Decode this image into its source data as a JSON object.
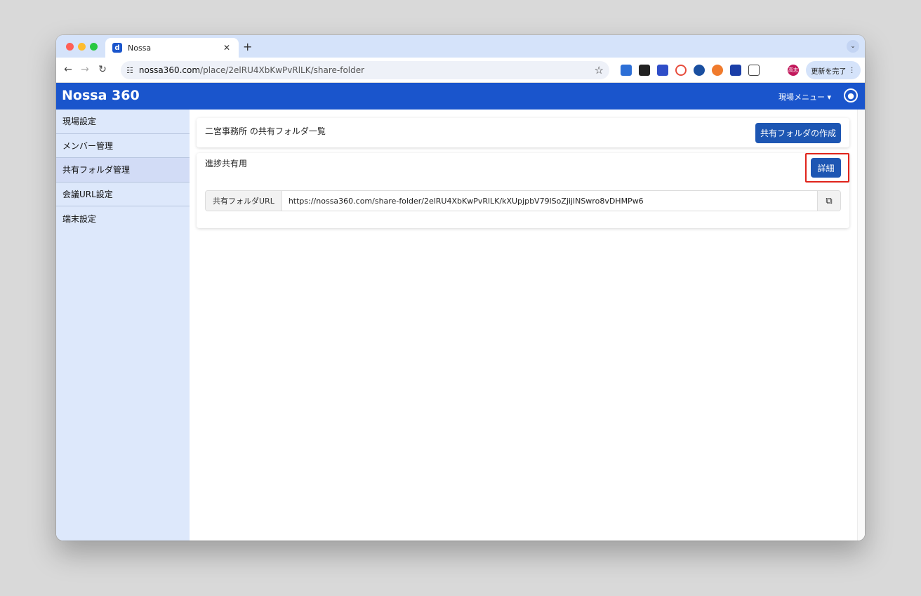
{
  "browser": {
    "tab_title": "Nossa",
    "tab_favicon": "nossa-favicon",
    "new_tab": "+",
    "url_host": "nossa360.com",
    "url_path": "/place/2elRU4XbKwPvRlLK/share-folder",
    "update_label": "更新を完了",
    "profile_initials": "高志"
  },
  "header": {
    "logo": "Nossa 360",
    "site_menu": "現場メニュー ▾"
  },
  "sidebar": {
    "items": [
      {
        "label": "現場設定"
      },
      {
        "label": "メンバー管理"
      },
      {
        "label": "共有フォルダ管理"
      },
      {
        "label": "会議URL設定"
      },
      {
        "label": "端末設定"
      }
    ]
  },
  "main": {
    "list_title": "二宮事務所 の共有フォルダ一覧",
    "create_button": "共有フォルダの作成",
    "folder": {
      "name": "進捗共有用",
      "detail_button": "詳細",
      "url_label": "共有フォルダURL",
      "url_value": "https://nossa360.com/share-folder/2elRU4XbKwPvRlLK/kXUpjpbV79lSoZjijlNSwro8vDHMPw6"
    }
  },
  "colors": {
    "brand": "#1a55cc",
    "button": "#1d56b3",
    "highlight": "#e0241b",
    "sidebar": "#dde8fb"
  }
}
